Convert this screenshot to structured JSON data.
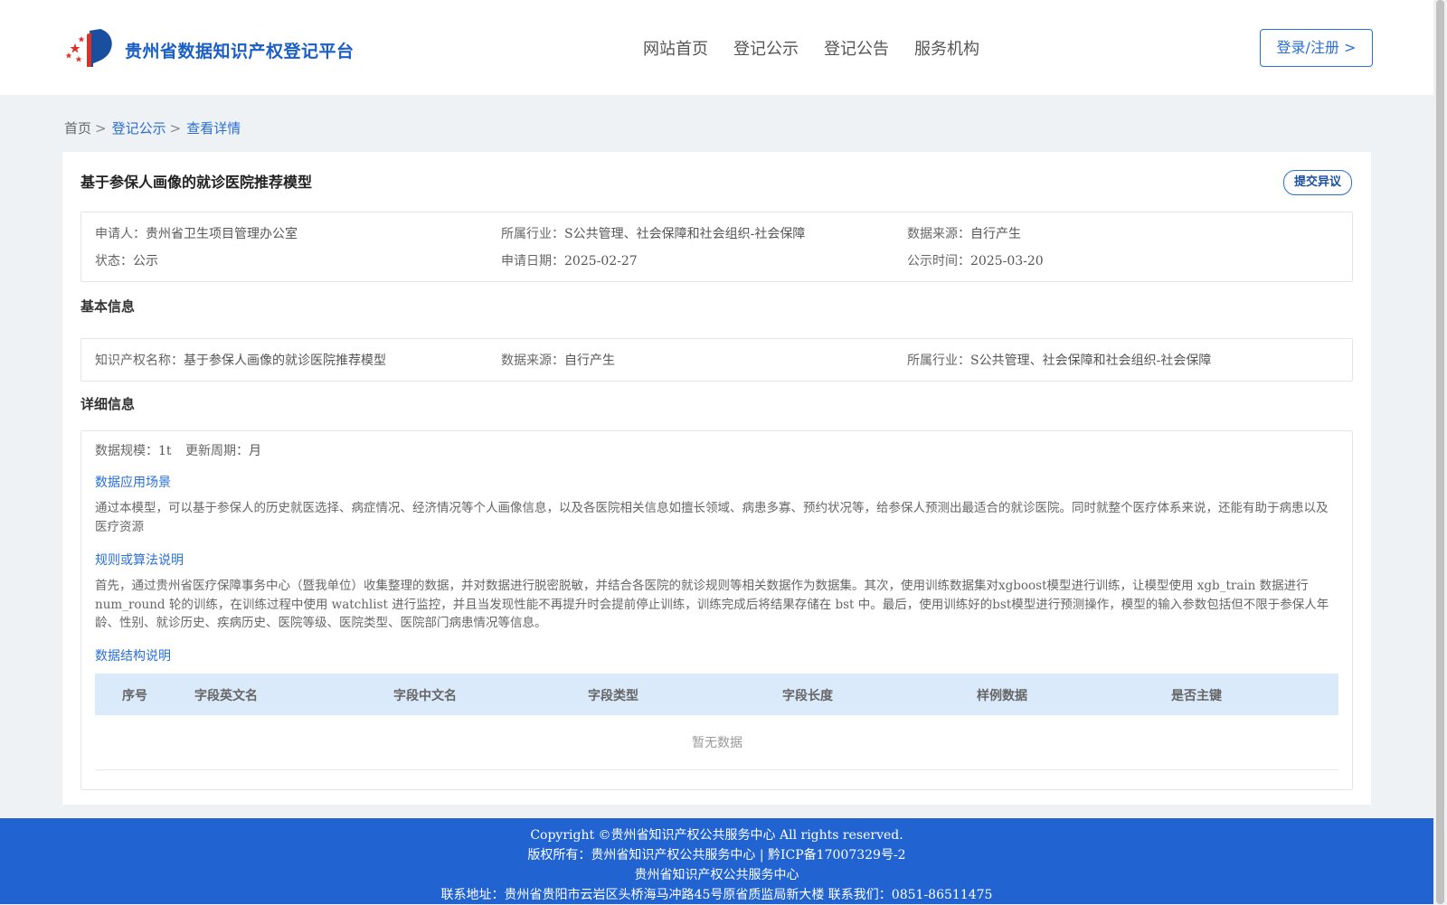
{
  "header": {
    "brand": "贵州省数据知识产权登记平台",
    "nav": [
      "网站首页",
      "登记公示",
      "登记公告",
      "服务机构"
    ],
    "login_label": "登录/注册 >"
  },
  "breadcrumb": {
    "items": [
      "首页",
      "登记公示",
      "查看详情"
    ],
    "sep": ">"
  },
  "record": {
    "title": "基于参保人画像的就诊医院推荐模型",
    "objection_label": "提交异议",
    "summary": {
      "applicant_label": "申请人：",
      "applicant": "贵州省卫生项目管理办公室",
      "industry_label": "所属行业：",
      "industry": "S公共管理、社会保障和社会组织-社会保障",
      "source_label": "数据来源：",
      "source": "自行产生",
      "status_label": "状态：",
      "status": "公示",
      "apply_date_label": "申请日期：",
      "apply_date": "2025-02-27",
      "publicity_label": "公示时间：",
      "publicity_date": "2025-03-20"
    },
    "basic": {
      "section_title": "基本信息",
      "ip_name_label": "知识产权名称：",
      "ip_name": "基于参保人画像的就诊医院推荐模型",
      "source_label": "数据来源：",
      "source": "自行产生",
      "industry_label": "所属行业：",
      "industry": "S公共管理、社会保障和社会组织-社会保障"
    },
    "detail": {
      "section_title": "详细信息",
      "scale_label": "数据规模：",
      "scale": "1t",
      "cycle_label": "更新周期：",
      "cycle": "月",
      "scenario_title": "数据应用场景",
      "scenario_text": "通过本模型，可以基于参保人的历史就医选择、病症情况、经济情况等个人画像信息，以及各医院相关信息如擅长领域、病患多寡、预约状况等，给参保人预测出最适合的就诊医院。同时就整个医疗体系来说，还能有助于病患以及医疗资源",
      "algorithm_title": "规则或算法说明",
      "algorithm_text": "首先，通过贵州省医疗保障事务中心（暨我单位）收集整理的数据，并对数据进行脱密脱敏，并结合各医院的就诊规则等相关数据作为数据集。其次，使用训练数据集对xgboost模型进行训练，让模型使用 xgb_train 数据进行 num_round 轮的训练，在训练过程中使用 watchlist 进行监控，并且当发现性能不再提升时会提前停止训练，训练完成后将结果存储在 bst 中。最后，使用训练好的bst模型进行预测操作，模型的输入参数包括但不限于参保人年龄、性别、就诊历史、疾病历史、医院等级、医院类型、医院部门病患情况等信息。",
      "structure_title": "数据结构说明",
      "table_headers": [
        "序号",
        "字段英文名",
        "字段中文名",
        "字段类型",
        "字段长度",
        "样例数据",
        "是否主键"
      ],
      "empty_text": "暂无数据"
    }
  },
  "footer": {
    "line1": "Copyright ©贵州省知识产权公共服务中心 All rights reserved.",
    "line2": "版权所有：贵州省知识产权公共服务中心 | 黔ICP备17007329号-2",
    "line3": "贵州省知识产权公共服务中心",
    "line4": "联系地址：贵州省贵阳市云岩区头桥海马冲路45号原省质监局新大楼 联系我们：0851-86511475"
  },
  "colors": {
    "accent": "#2a6fd6",
    "footer_bg": "#2163d0",
    "table_header_bg": "#dbeafa"
  }
}
